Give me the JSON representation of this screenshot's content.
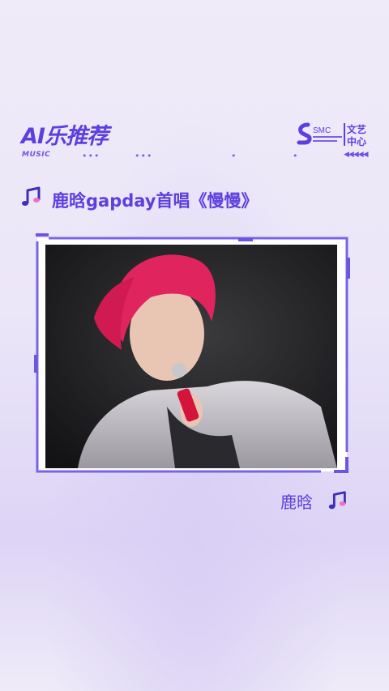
{
  "header": {
    "title": "AI乐推荐",
    "subtitle": "MUSIC",
    "logo_text": "SMC",
    "logo_badge_line1": "文艺",
    "logo_badge_line2": "中心",
    "arrows": "◀◀◀◀◀"
  },
  "song": {
    "title": "鹿晗gapday首唱《慢慢》",
    "artist": "鹿晗"
  },
  "icons": {
    "note": "music-note-icon",
    "logo": "smc-logo-icon"
  },
  "colors": {
    "accent": "#5b3fe0",
    "background": "#ece7f8"
  }
}
